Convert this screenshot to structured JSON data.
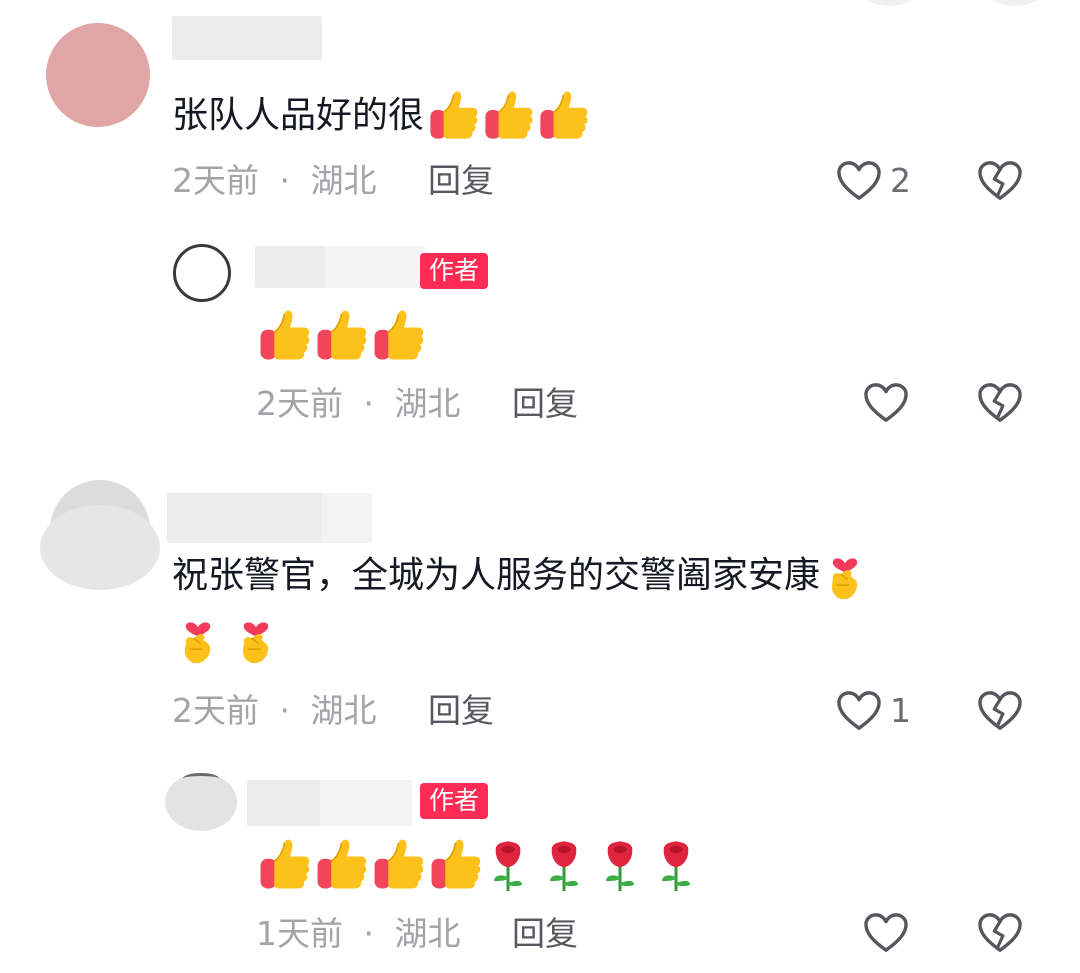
{
  "comments": [
    {
      "text": "张队人品好的很",
      "trailing_emojis": [
        "thumbs-up",
        "thumbs-up",
        "thumbs-up"
      ],
      "time": "2天前",
      "sep": "·",
      "location": "湖北",
      "reply_label": "回复",
      "likes": "2",
      "avatar_color": "#e0a6a6",
      "reply": {
        "badge": "作者",
        "emojis": [
          "thumbs-up",
          "thumbs-up",
          "thumbs-up"
        ],
        "time": "2天前",
        "sep": "·",
        "location": "湖北",
        "reply_label": "回复",
        "likes": ""
      }
    },
    {
      "text": "祝张警官，全城为人服务的交警阖家安康",
      "trailing_emojis": [
        "finger-heart"
      ],
      "line2_emojis": [
        "finger-heart",
        "finger-heart"
      ],
      "time": "2天前",
      "sep": "·",
      "location": "湖北",
      "reply_label": "回复",
      "likes": "1",
      "reply": {
        "badge": "作者",
        "emojis": [
          "thumbs-up",
          "thumbs-up",
          "thumbs-up",
          "thumbs-up",
          "rose",
          "rose",
          "rose",
          "rose"
        ],
        "time": "1天前",
        "sep": "·",
        "location": "湖北",
        "reply_label": "回复",
        "likes": ""
      }
    }
  ],
  "colors": {
    "author_badge": "#fe2c55",
    "meta_text": "#a3a3a8",
    "reply_text": "#58595f"
  },
  "icons": {
    "like": "heart-outline-icon",
    "dislike": "broken-heart-icon"
  }
}
